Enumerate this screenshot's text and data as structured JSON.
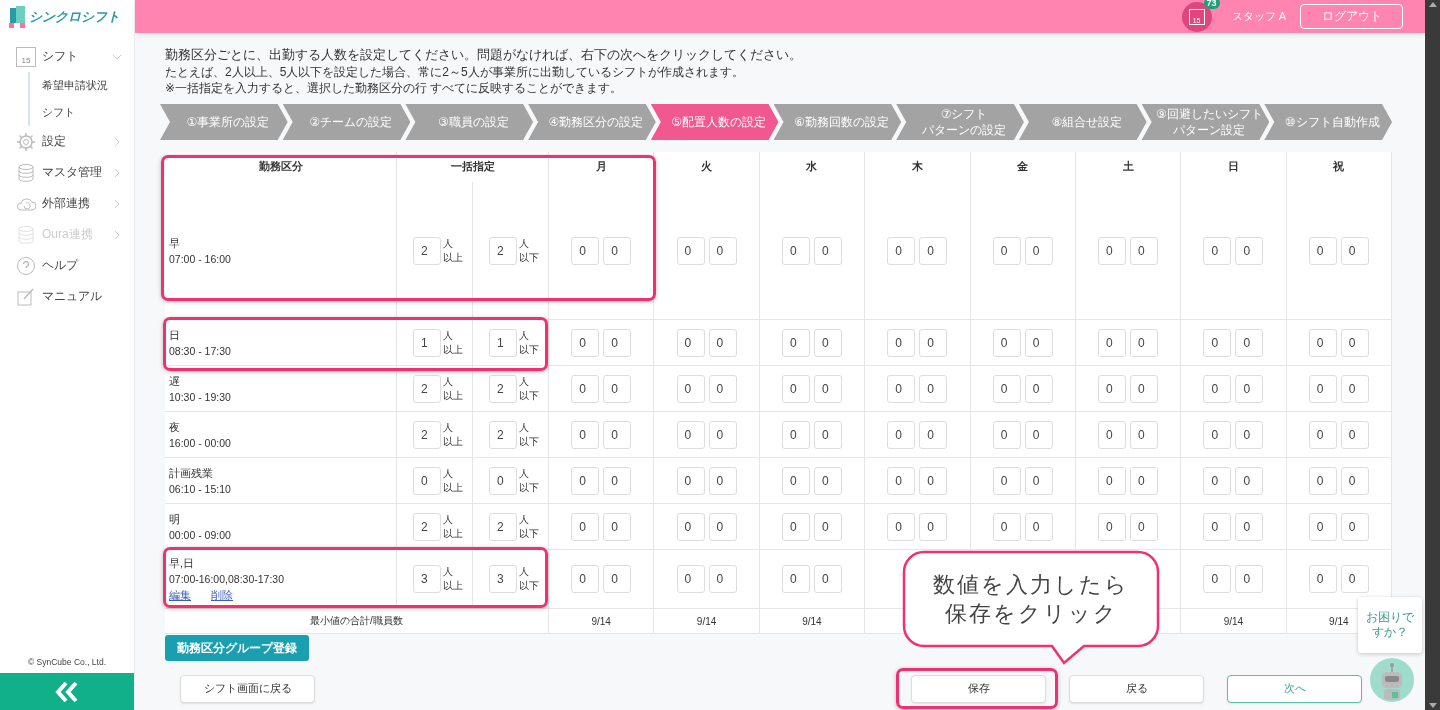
{
  "logo": {
    "text": "シンクロシフト"
  },
  "sidebar": {
    "items": [
      {
        "label": "シフト",
        "calendar_day": "15",
        "expanded": true,
        "disabled": false,
        "children": [
          {
            "label": "希望申請状況"
          },
          {
            "label": "シフト"
          }
        ]
      },
      {
        "label": "設定",
        "expanded": false,
        "disabled": false
      },
      {
        "label": "マスタ管理",
        "expanded": false,
        "disabled": false
      },
      {
        "label": "外部連携",
        "expanded": false,
        "disabled": false
      },
      {
        "label": "Oura連携",
        "expanded": false,
        "disabled": true
      },
      {
        "label": "ヘルプ",
        "disabled": false
      },
      {
        "label": "マニュアル",
        "disabled": false
      }
    ],
    "copyright": "© SynCube Co., Ltd."
  },
  "header": {
    "calendar_day": "15",
    "badge": "73",
    "user": "スタッフ A",
    "logout": "ログアウト"
  },
  "instructions": [
    "勤務区分ごとに、出勤する人数を設定してください。問題がなければ、右下の次へをクリックしてください。",
    "たとえば、2人以上、5人以下を設定した場合、常に2～5人が事業所に出勤しているシフトが作成されます。",
    "※一括指定を入力すると、選択した勤務区分の行 すべてに反映することができます。"
  ],
  "steps": [
    {
      "lines": [
        "①事業所の設定"
      ],
      "selected": false
    },
    {
      "lines": [
        "②チームの設定"
      ],
      "selected": false
    },
    {
      "lines": [
        "③職員の設定"
      ],
      "selected": false
    },
    {
      "lines": [
        "④勤務区分の設定"
      ],
      "selected": false
    },
    {
      "lines": [
        "⑤配置人数の設定"
      ],
      "selected": true
    },
    {
      "lines": [
        "⑥勤務回数の設定"
      ],
      "selected": false
    },
    {
      "lines": [
        "⑦シフト",
        "パターンの設定"
      ],
      "selected": false
    },
    {
      "lines": [
        "⑧組合せ設定"
      ],
      "selected": false
    },
    {
      "lines": [
        "⑨回避したいシフト",
        "パターン設定"
      ],
      "selected": false
    },
    {
      "lines": [
        "⑩シフト自動作成"
      ],
      "selected": false
    }
  ],
  "table": {
    "columns": [
      "勤務区分",
      "一括指定",
      "月",
      "火",
      "水",
      "木",
      "金",
      "土",
      "日",
      "祝"
    ],
    "rows": [
      {
        "name": "早",
        "time": "07:00 - 16:00",
        "bulk": [
          {
            "value": "2",
            "unit": "人",
            "range": "以上"
          },
          {
            "value": "2",
            "unit": "人",
            "range": "以下"
          }
        ],
        "days": [
          {
            "min": "0",
            "max": "0"
          },
          {
            "min": "0",
            "max": "0"
          },
          {
            "min": "0",
            "max": "0"
          },
          {
            "min": "0",
            "max": "0"
          },
          {
            "min": "0",
            "max": "0"
          },
          {
            "min": "0",
            "max": "0"
          },
          {
            "min": "0",
            "max": "0"
          },
          {
            "min": "0",
            "max": "0"
          }
        ]
      },
      {
        "name": "日",
        "time": "08:30 - 17:30",
        "bulk": [
          {
            "value": "1",
            "unit": "人",
            "range": "以上"
          },
          {
            "value": "1",
            "unit": "人",
            "range": "以下"
          }
        ],
        "days": [
          {
            "min": "0",
            "max": "0"
          },
          {
            "min": "0",
            "max": "0"
          },
          {
            "min": "0",
            "max": "0"
          },
          {
            "min": "0",
            "max": "0"
          },
          {
            "min": "0",
            "max": "0"
          },
          {
            "min": "0",
            "max": "0"
          },
          {
            "min": "0",
            "max": "0"
          },
          {
            "min": "0",
            "max": "0"
          }
        ]
      },
      {
        "name": "遅",
        "time": "10:30 - 19:30",
        "bulk": [
          {
            "value": "2",
            "unit": "人",
            "range": "以上"
          },
          {
            "value": "2",
            "unit": "人",
            "range": "以下"
          }
        ],
        "days": [
          {
            "min": "0",
            "max": "0"
          },
          {
            "min": "0",
            "max": "0"
          },
          {
            "min": "0",
            "max": "0"
          },
          {
            "min": "0",
            "max": "0"
          },
          {
            "min": "0",
            "max": "0"
          },
          {
            "min": "0",
            "max": "0"
          },
          {
            "min": "0",
            "max": "0"
          },
          {
            "min": "0",
            "max": "0"
          }
        ]
      },
      {
        "name": "夜",
        "time": "16:00 - 00:00",
        "bulk": [
          {
            "value": "2",
            "unit": "人",
            "range": "以上"
          },
          {
            "value": "2",
            "unit": "人",
            "range": "以下"
          }
        ],
        "days": [
          {
            "min": "0",
            "max": "0"
          },
          {
            "min": "0",
            "max": "0"
          },
          {
            "min": "0",
            "max": "0"
          },
          {
            "min": "0",
            "max": "0"
          },
          {
            "min": "0",
            "max": "0"
          },
          {
            "min": "0",
            "max": "0"
          },
          {
            "min": "0",
            "max": "0"
          },
          {
            "min": "0",
            "max": "0"
          }
        ]
      },
      {
        "name": "計画残業",
        "time": "06:10 - 15:10",
        "bulk": [
          {
            "value": "0",
            "unit": "人",
            "range": "以上"
          },
          {
            "value": "0",
            "unit": "人",
            "range": "以下"
          }
        ],
        "days": [
          {
            "min": "0",
            "max": "0"
          },
          {
            "min": "0",
            "max": "0"
          },
          {
            "min": "0",
            "max": "0"
          },
          {
            "min": "0",
            "max": "0"
          },
          {
            "min": "0",
            "max": "0"
          },
          {
            "min": "0",
            "max": "0"
          },
          {
            "min": "0",
            "max": "0"
          },
          {
            "min": "0",
            "max": "0"
          }
        ]
      },
      {
        "name": "明",
        "time": "00:00 - 09:00",
        "bulk": [
          {
            "value": "2",
            "unit": "人",
            "range": "以上"
          },
          {
            "value": "2",
            "unit": "人",
            "range": "以下"
          }
        ],
        "days": [
          {
            "min": "0",
            "max": "0"
          },
          {
            "min": "0",
            "max": "0"
          },
          {
            "min": "0",
            "max": "0"
          },
          {
            "min": "0",
            "max": "0"
          },
          {
            "min": "0",
            "max": "0"
          },
          {
            "min": "0",
            "max": "0"
          },
          {
            "min": "0",
            "max": "0"
          },
          {
            "min": "0",
            "max": "0"
          }
        ]
      },
      {
        "name": "早,日",
        "time": "07:00-16:00,08:30-17:30",
        "links": [
          "編集",
          "削除"
        ],
        "bulk": [
          {
            "value": "3",
            "unit": "人",
            "range": "以上"
          },
          {
            "value": "3",
            "unit": "人",
            "range": "以下"
          }
        ],
        "days": [
          {
            "min": "0",
            "max": "0"
          },
          {
            "min": "0",
            "max": "0"
          },
          {
            "min": "0",
            "max": "0"
          }
        ],
        "trailing_days": [
          {
            "min": "0",
            "max": "0"
          },
          {
            "min": "0",
            "max": "0"
          }
        ]
      }
    ],
    "footer": {
      "label": "最小値の合計/職員数",
      "totals": [
        "9/14",
        "9/14",
        "9/14"
      ],
      "trailing_totals": [
        "9/14",
        "9/14"
      ]
    }
  },
  "group_button": "勤務区分グループ登録",
  "buttons": [
    {
      "label": "シフト画面に戻る",
      "kind": "plain"
    },
    {
      "label": "保存",
      "kind": "plain"
    },
    {
      "label": "戻る",
      "kind": "plain"
    },
    {
      "label": "次へ",
      "kind": "primary"
    }
  ],
  "callout": [
    "数値を入力したら",
    "保存をクリック"
  ],
  "help": "お困りですか？"
}
